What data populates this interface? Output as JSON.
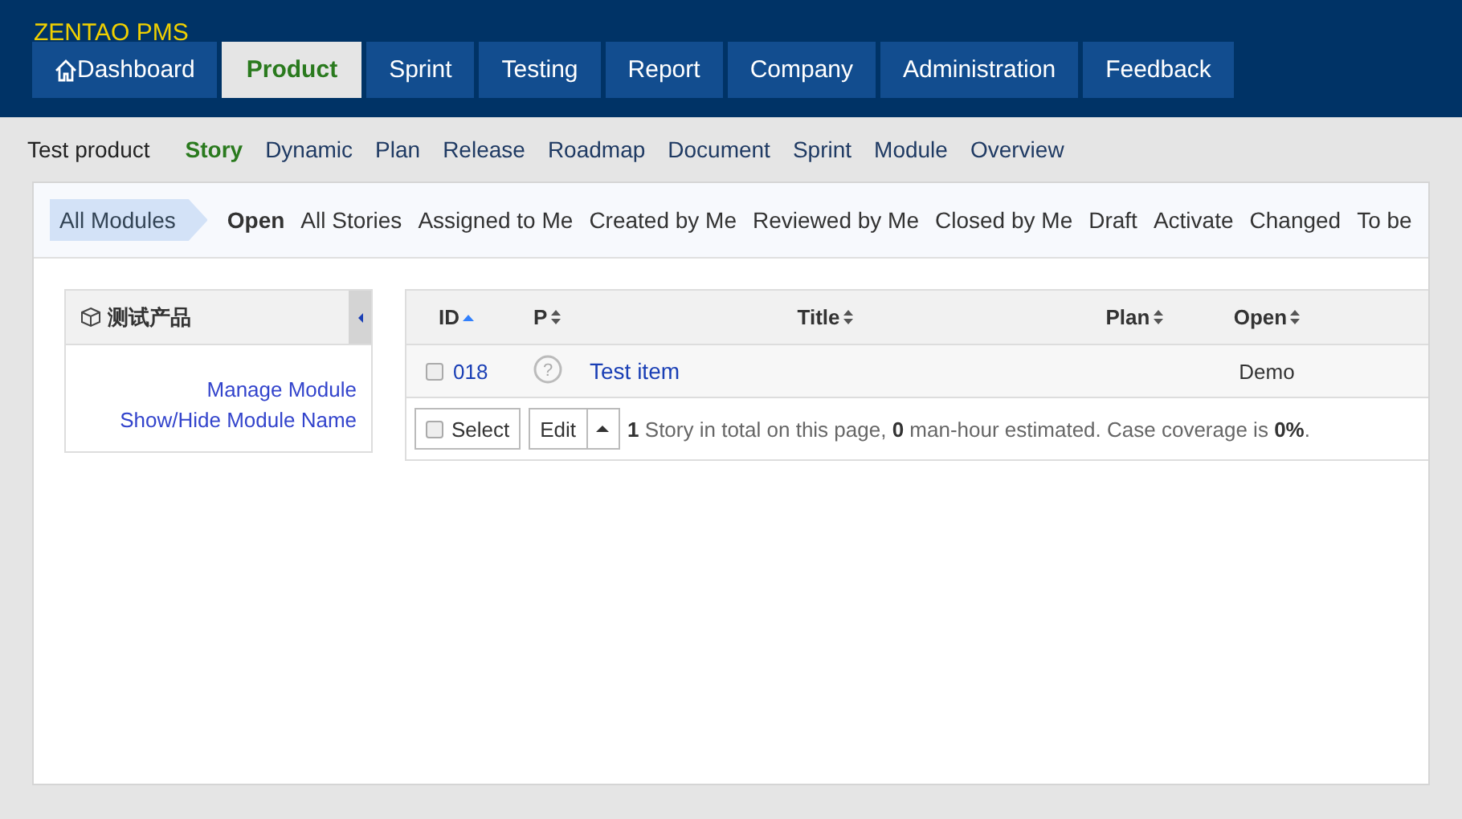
{
  "brand": "ZENTAO PMS",
  "main_tabs": [
    {
      "label": "Dashboard",
      "kind": "home",
      "selected": false
    },
    {
      "label": "Product",
      "kind": "text",
      "selected": true
    },
    {
      "label": "Sprint",
      "kind": "text",
      "selected": false
    },
    {
      "label": "Testing",
      "kind": "text",
      "selected": false
    },
    {
      "label": "Report",
      "kind": "text",
      "selected": false
    },
    {
      "label": "Company",
      "kind": "text",
      "selected": false
    },
    {
      "label": "Administration",
      "kind": "text",
      "selected": false
    },
    {
      "label": "Feedback",
      "kind": "text",
      "selected": false
    }
  ],
  "sub_nav": {
    "product": "Test product",
    "items": [
      {
        "label": "Story",
        "selected": true
      },
      {
        "label": "Dynamic",
        "selected": false
      },
      {
        "label": "Plan",
        "selected": false
      },
      {
        "label": "Release",
        "selected": false
      },
      {
        "label": "Roadmap",
        "selected": false
      },
      {
        "label": "Document",
        "selected": false
      },
      {
        "label": "Sprint",
        "selected": false
      },
      {
        "label": "Module",
        "selected": false
      },
      {
        "label": "Overview",
        "selected": false
      }
    ]
  },
  "filter_bar": {
    "module": "All Modules",
    "items": [
      {
        "label": "Open",
        "selected": true
      },
      {
        "label": "All Stories",
        "selected": false
      },
      {
        "label": "Assigned to Me",
        "selected": false
      },
      {
        "label": "Created by Me",
        "selected": false
      },
      {
        "label": "Reviewed by Me",
        "selected": false
      },
      {
        "label": "Closed by Me",
        "selected": false
      },
      {
        "label": "Draft",
        "selected": false
      },
      {
        "label": "Activate",
        "selected": false
      },
      {
        "label": "Changed",
        "selected": false
      },
      {
        "label": "To be",
        "selected": false
      }
    ]
  },
  "module_panel": {
    "title": "测试产品",
    "links": [
      "Manage Module",
      "Show/Hide Module Name"
    ]
  },
  "table": {
    "columns": [
      {
        "label": "ID",
        "sorted": true
      },
      {
        "label": "P",
        "sorted": false
      },
      {
        "label": "Title",
        "sorted": false
      },
      {
        "label": "Plan",
        "sorted": false
      },
      {
        "label": "Open",
        "sorted": false
      }
    ],
    "rows": [
      {
        "checked": false,
        "id": "018",
        "priority": "?",
        "title": "Test item",
        "open": "Demo"
      }
    ],
    "footer": {
      "select": "Select",
      "select_checked": false,
      "edit": "Edit",
      "summary": "**1** Story in total on this page, **0** man-hour estimated. Case coverage is **0%**."
    }
  }
}
